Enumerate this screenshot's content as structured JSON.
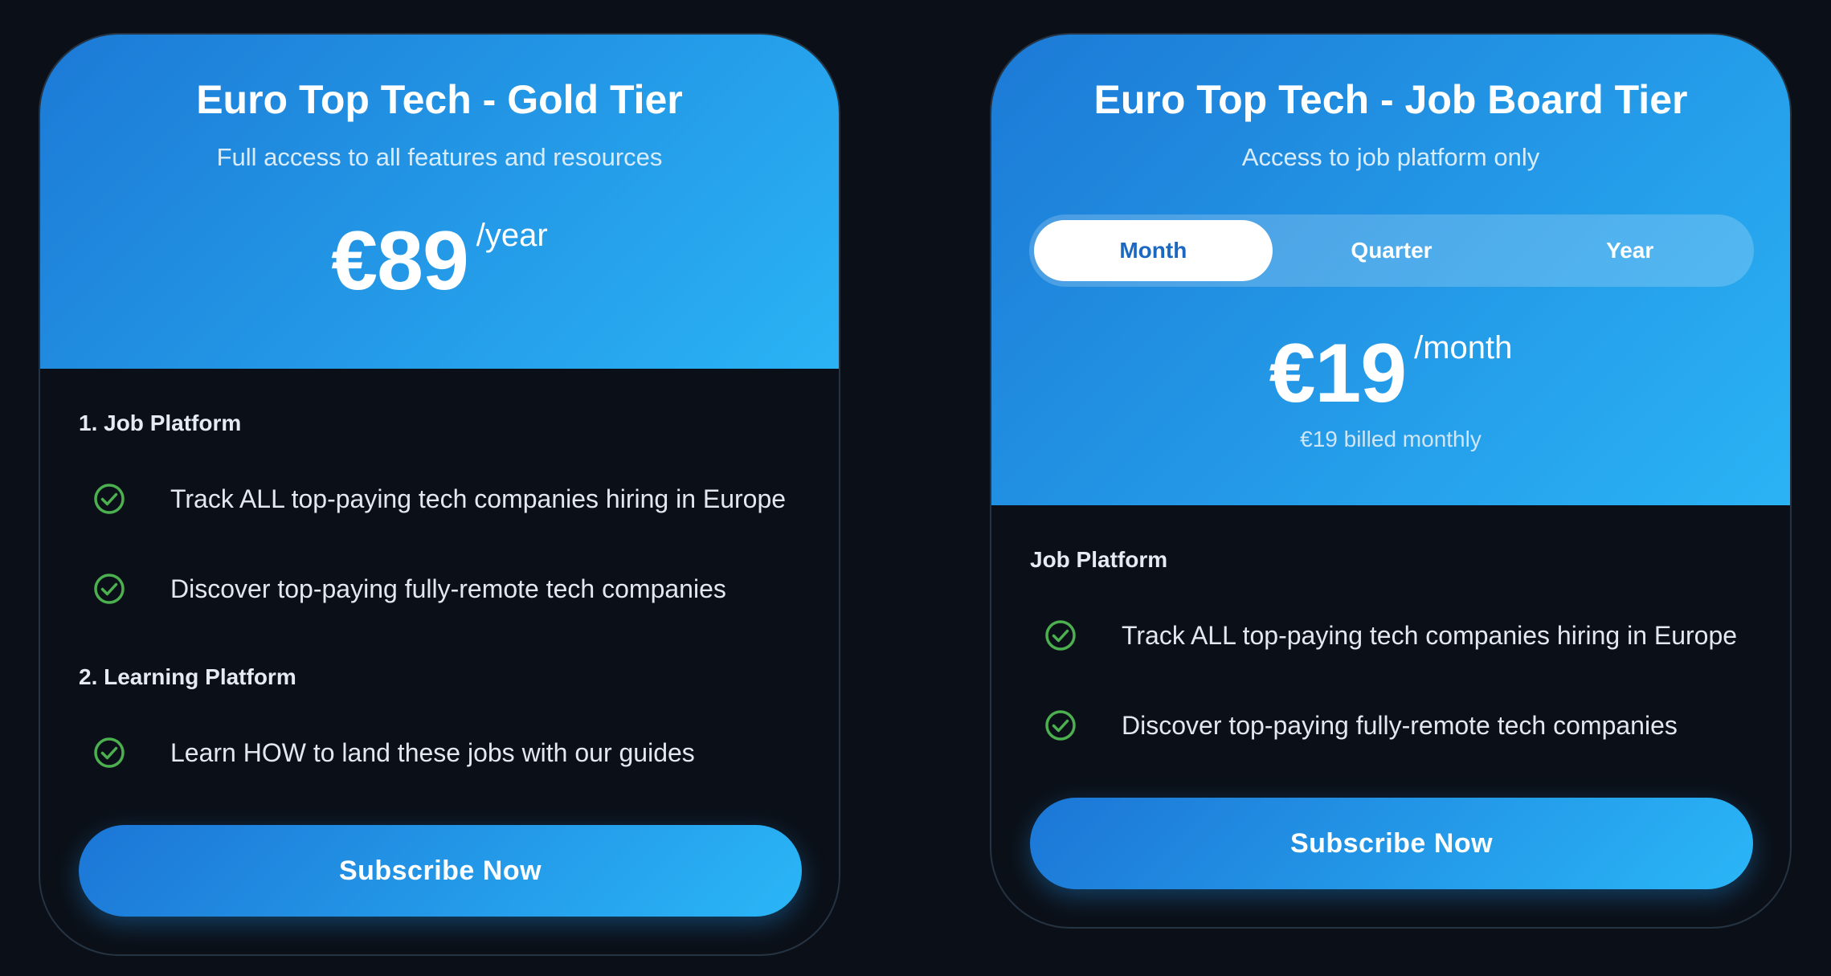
{
  "colors": {
    "page_bg": "#0b1018",
    "header_gradient_start": "#1c7ad6",
    "header_gradient_end": "#2ab3f5",
    "check_green": "#4caf50",
    "toggle_active_text": "#1c67c0"
  },
  "gold_card": {
    "title": "Euro Top Tech - Gold Tier",
    "subtitle": "Full access to all features and resources",
    "price": "€89",
    "period": "/year",
    "sections": [
      {
        "title": "1. Job Platform",
        "features": [
          {
            "icon": "check-circle-icon",
            "text": "Track ALL top-paying tech companies hiring in Europe"
          },
          {
            "icon": "check-circle-icon",
            "text": "Discover top-paying fully-remote tech companies"
          }
        ]
      },
      {
        "title": "2. Learning Platform",
        "features": [
          {
            "icon": "check-circle-icon",
            "text": "Learn HOW to land these jobs with our guides"
          }
        ]
      }
    ],
    "button_label": "Subscribe Now"
  },
  "job_card": {
    "title": "Euro Top Tech - Job Board Tier",
    "subtitle": "Access to job platform only",
    "billing_options": [
      "Month",
      "Quarter",
      "Year"
    ],
    "selected_option": "Month",
    "price": "€19",
    "period": "/month",
    "billed_note": "€19 billed monthly",
    "section_title": "Job Platform",
    "features": [
      {
        "icon": "check-circle-icon",
        "text": "Track ALL top-paying tech companies hiring in Europe"
      },
      {
        "icon": "check-circle-icon",
        "text": "Discover top-paying fully-remote tech companies"
      }
    ],
    "button_label": "Subscribe Now"
  }
}
